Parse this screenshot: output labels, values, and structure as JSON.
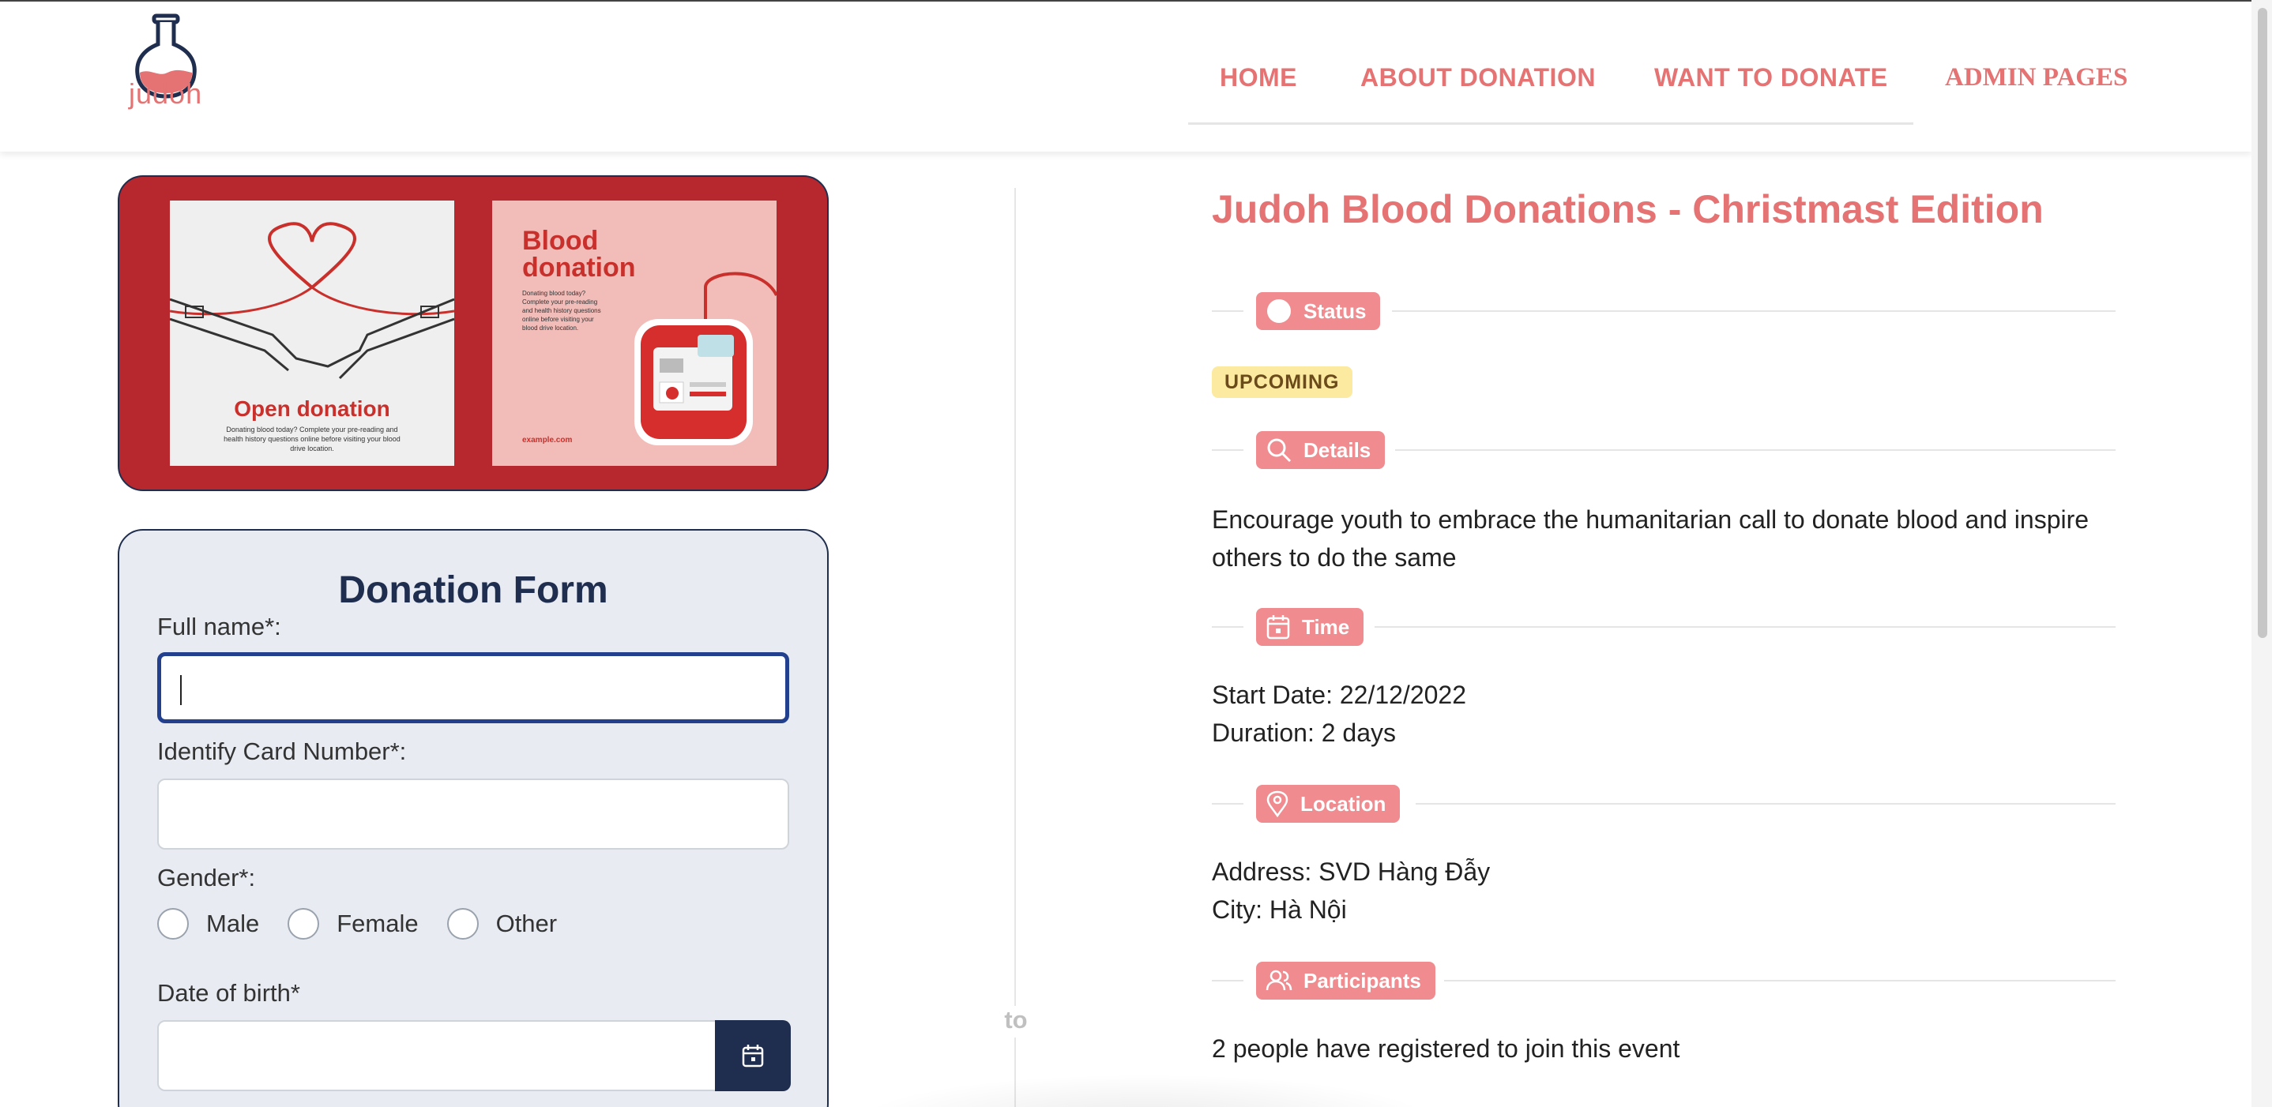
{
  "logo": {
    "text": "judoh",
    "icon": "flask-icon"
  },
  "nav": {
    "home": "HOME",
    "about": "ABOUT DONATION",
    "donate": "WANT TO DONATE",
    "admin": "ADMIN PAGES"
  },
  "banner": {
    "poster1_title": "Open donation",
    "poster1_text": "Donating blood today? Complete your pre-reading and health history questions online before visiting your blood drive location.",
    "poster2_title_line1": "Blood",
    "poster2_title_line2": "donation",
    "poster2_text": "Donating blood today? Complete your pre-reading and health history questions online before visiting your blood drive location.",
    "poster2_url": "example.com"
  },
  "form": {
    "title": "Donation Form",
    "full_name_label": "Full name*:",
    "full_name_value": "",
    "id_card_label": "Identify Card Number*:",
    "id_card_value": "",
    "gender_label": "Gender*:",
    "gender_options": [
      "Male",
      "Female",
      "Other"
    ],
    "dob_label": "Date of birth*",
    "dob_value": ""
  },
  "divider_label": "to",
  "event": {
    "title": "Judoh Blood Donations - Christmast Edition",
    "status_chip": "Status",
    "status_badge": "UPCOMING",
    "details_chip": "Details",
    "details_text": "Encourage youth to embrace the humanitarian call to donate blood and inspire others to do the same",
    "time_chip": "Time",
    "start_date": "Start Date: 22/12/2022",
    "duration": "Duration: 2 days",
    "location_chip": "Location",
    "address": "Address: SVD Hàng Đẫy",
    "city": "City: Hà Nội",
    "participants_chip": "Participants",
    "participants_text": "2 people have registered to join this event"
  },
  "colors": {
    "brand": "#e57373",
    "chip": "#f08c8f",
    "navy": "#1f2d4e",
    "banner": "#b7282e",
    "badge": "#fbeaa0"
  }
}
